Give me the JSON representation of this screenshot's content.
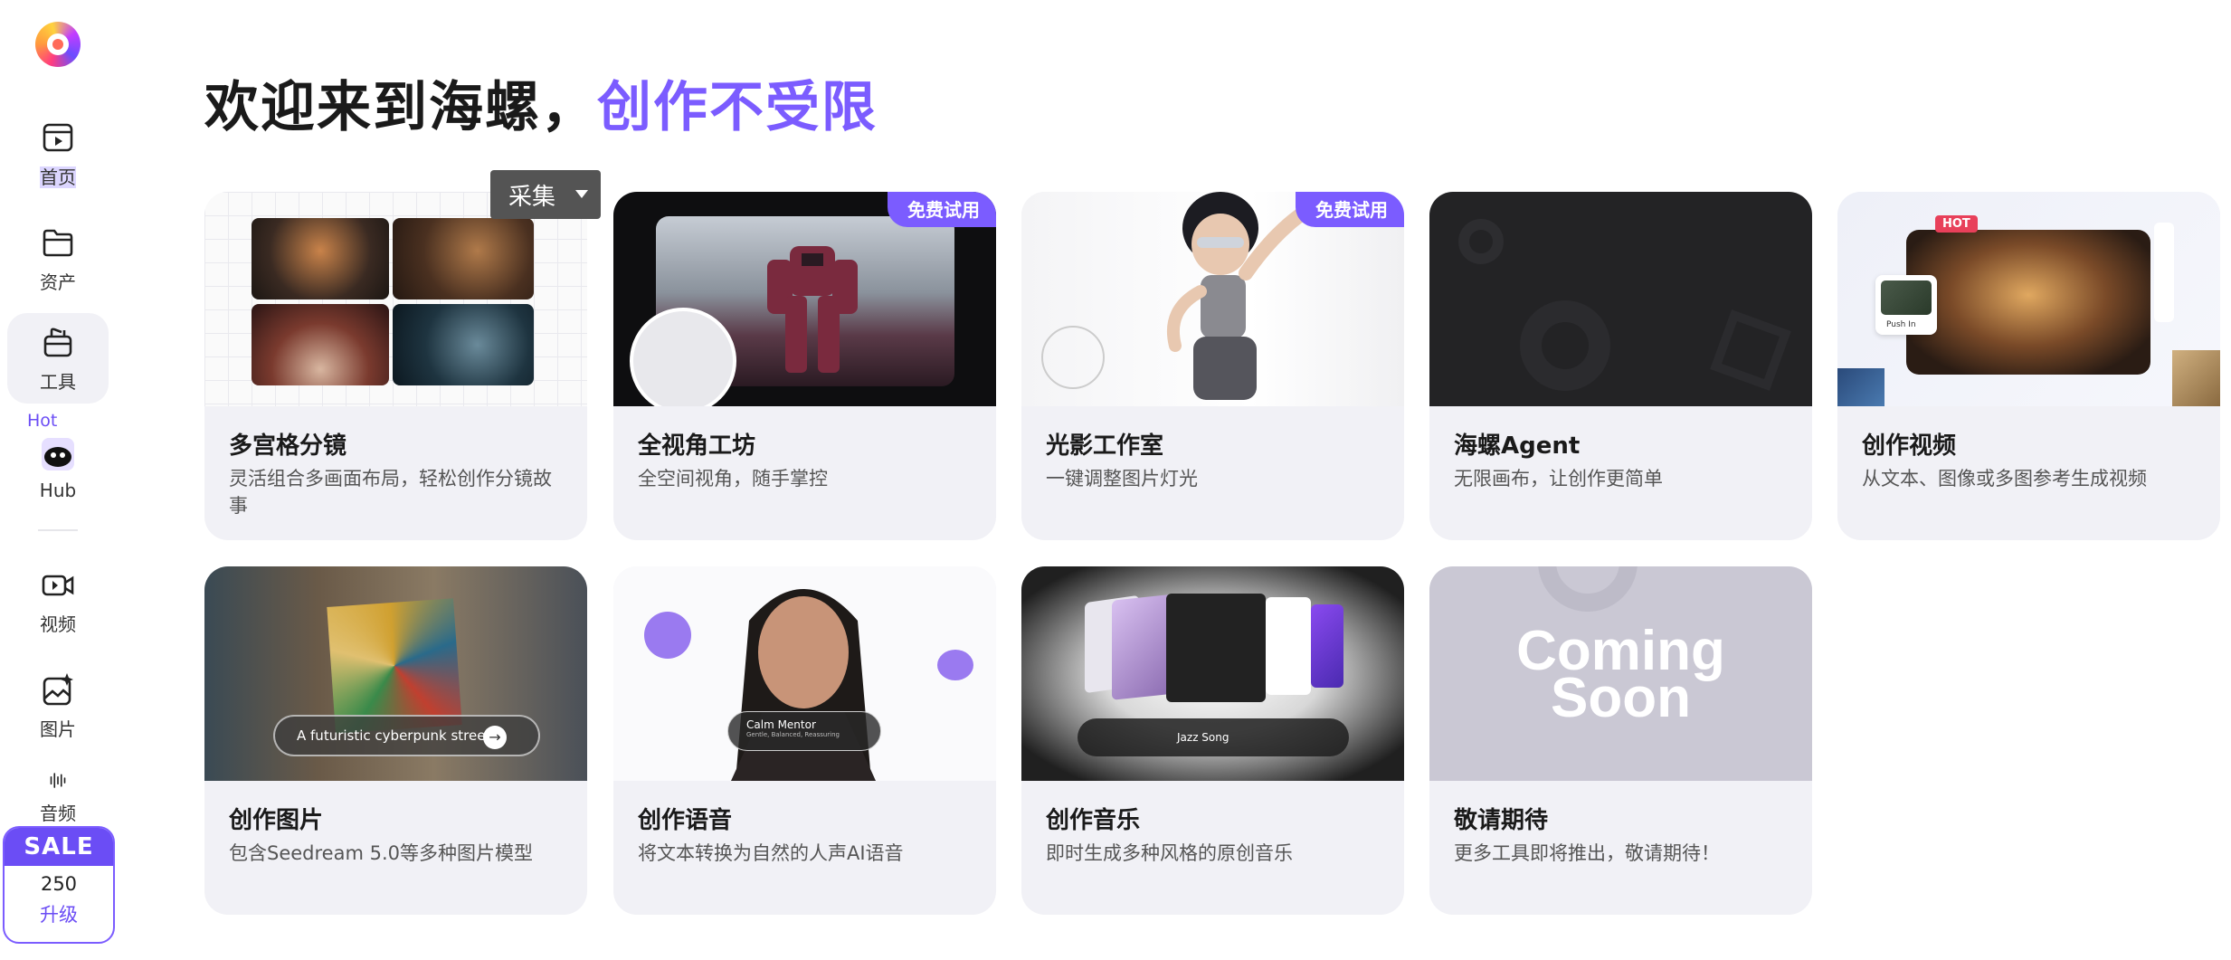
{
  "sidebar": {
    "items": [
      {
        "label": "首页",
        "icon": "home-play-icon"
      },
      {
        "label": "资产",
        "icon": "folder-icon"
      },
      {
        "label": "工具",
        "icon": "toolbox-icon",
        "active": true
      },
      {
        "label": "Hub",
        "icon": "hub-avatar-icon",
        "tag": "Hot"
      },
      {
        "label": "视频",
        "icon": "video-camera-icon"
      },
      {
        "label": "图片",
        "icon": "image-sparkle-icon"
      },
      {
        "label": "音频",
        "icon": "audio-wave-icon"
      }
    ],
    "sale": {
      "badge": "SALE",
      "credits": "250",
      "upgrade": "升级"
    }
  },
  "header": {
    "title_main": "欢迎来到海螺，",
    "title_accent": "创作不受限"
  },
  "tooltip": {
    "label": "采集"
  },
  "cards": [
    {
      "title": "多宫格分镜",
      "desc": "灵活组合多画面布局，轻松创作分镜故事",
      "badge": ""
    },
    {
      "title": "全视角工坊",
      "desc": "全空间视角，随手掌控",
      "badge": "免费试用"
    },
    {
      "title": "光影工作室",
      "desc": "一键调整图片灯光",
      "badge": "免费试用"
    },
    {
      "title": "海螺Agent",
      "desc": "无限画布，让创作更简单",
      "badge": ""
    },
    {
      "title": "创作视频",
      "desc": "从文本、图像或多图参考生成视频",
      "badge": ""
    },
    {
      "title": "创作图片",
      "desc": "包含Seedream 5.0等多种图片模型",
      "badge": ""
    },
    {
      "title": "创作语音",
      "desc": "将文本转换为自然的人声AI语音",
      "badge": ""
    },
    {
      "title": "创作音乐",
      "desc": "即时生成多种风格的原创音乐",
      "badge": ""
    },
    {
      "title": "敬请期待",
      "desc": "更多工具即将推出，敬请期待！",
      "badge": ""
    }
  ],
  "thumb_text": {
    "video_hot": "HOT",
    "video_push": "Push In",
    "image_prompt": "A futuristic cyberpunk street |",
    "voice_name": "Calm Mentor",
    "voice_sub": "Gentle, Balanced, Reassuring",
    "music_track": "Jazz Song",
    "coming_soon_1": "Coming",
    "coming_soon_2": "Soon"
  },
  "colors": {
    "accent": "#7b5cff",
    "card_bg": "#f1f1f6",
    "sale": "#6b4df5"
  }
}
